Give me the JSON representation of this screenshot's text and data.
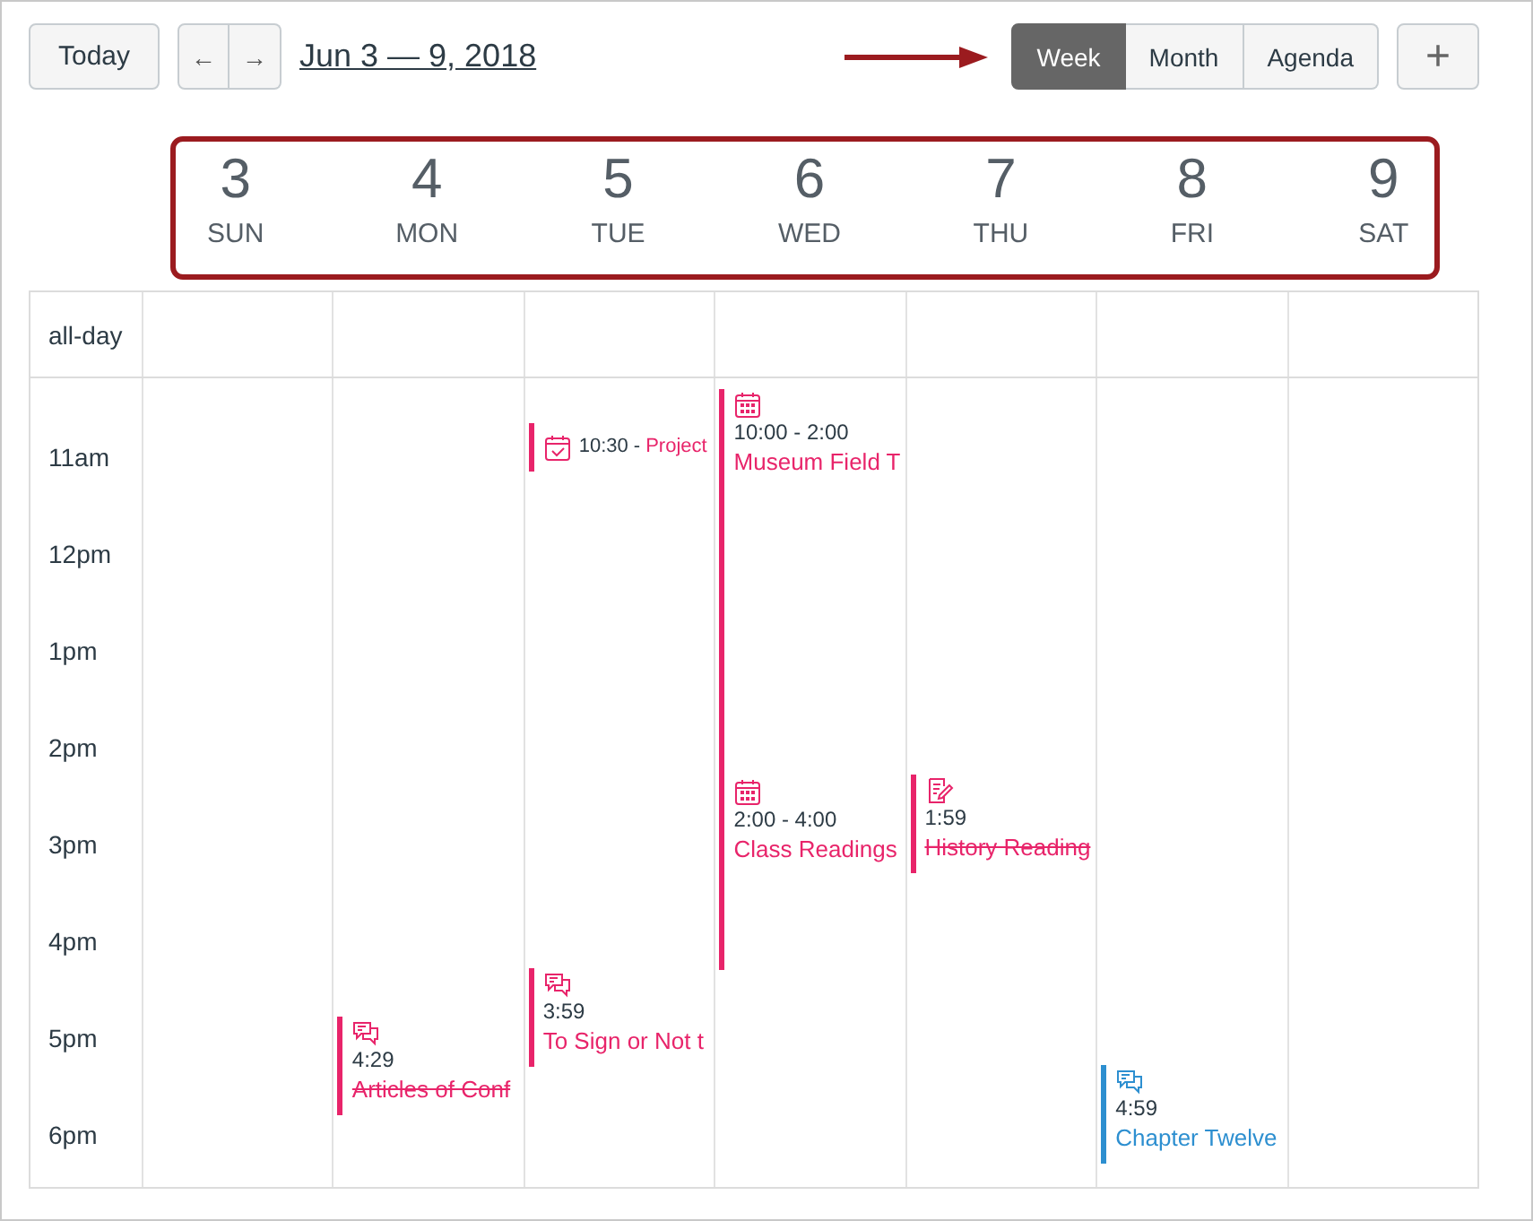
{
  "toolbar": {
    "today": "Today",
    "prev": "←",
    "next": "→",
    "date_range": "Jun 3 — 9, 2018",
    "views": [
      {
        "label": "Week",
        "selected": true
      },
      {
        "label": "Month",
        "selected": false
      },
      {
        "label": "Agenda",
        "selected": false
      }
    ],
    "add": "+"
  },
  "all_day_label": "all-day",
  "hours": [
    "11am",
    "12pm",
    "1pm",
    "2pm",
    "3pm",
    "4pm",
    "5pm",
    "6pm"
  ],
  "days": [
    {
      "number": "3",
      "weekday": "SUN"
    },
    {
      "number": "4",
      "weekday": "MON",
      "events": [
        {
          "kind": "discussion",
          "time": "4:29",
          "title": "Articles of Conf",
          "completed": true,
          "compact": false,
          "color": "#e8246a"
        }
      ]
    },
    {
      "number": "5",
      "weekday": "TUE",
      "events": [
        {
          "kind": "task",
          "time": "10:30 -",
          "title": "Project",
          "completed": false,
          "compact": true,
          "color": "#e8246a"
        },
        {
          "kind": "discussion",
          "time": "3:59",
          "title": "To Sign or Not t",
          "completed": false,
          "compact": false,
          "color": "#e8246a"
        }
      ]
    },
    {
      "number": "6",
      "weekday": "WED",
      "events": [
        {
          "kind": "event",
          "time": "10:00 - 2:00",
          "title": "Museum Field T",
          "completed": false,
          "compact": false,
          "color": "#e8246a"
        },
        {
          "kind": "event",
          "time": "2:00 - 4:00",
          "title": "Class Readings",
          "completed": false,
          "compact": false,
          "color": "#e8246a"
        }
      ]
    },
    {
      "number": "7",
      "weekday": "THU",
      "events": [
        {
          "kind": "assignment",
          "time": "1:59",
          "title": "History Reading",
          "completed": true,
          "compact": false,
          "color": "#e8246a"
        }
      ]
    },
    {
      "number": "8",
      "weekday": "FRI",
      "events": [
        {
          "kind": "discussion",
          "time": "4:59",
          "title": "Chapter Twelve",
          "completed": false,
          "compact": false,
          "color": "#2d8fd0"
        }
      ]
    },
    {
      "number": "9",
      "weekday": "SAT"
    }
  ]
}
